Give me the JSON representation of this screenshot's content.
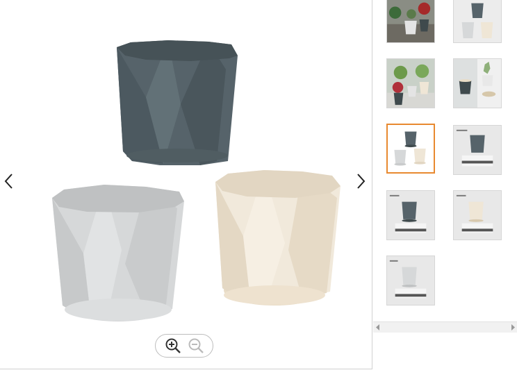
{
  "viewer": {
    "main_image_icon": "geometric-flower-pots-photo",
    "prev_icon": "chevron-left-icon",
    "next_icon": "chevron-right-icon",
    "zoom_in_icon": "zoom-in-icon",
    "zoom_out_icon": "zoom-out-icon"
  },
  "thumbnails": [
    {
      "icon": "pots-with-plants-photo",
      "selected": false
    },
    {
      "icon": "three-pots-photo",
      "selected": false
    },
    {
      "icon": "pots-with-plants-window-photo",
      "selected": false
    },
    {
      "icon": "pot-with-succulent-photo",
      "selected": false
    },
    {
      "icon": "three-pots-photo",
      "selected": true
    },
    {
      "icon": "dark-pot-size-chart",
      "selected": false
    },
    {
      "icon": "dark-pot-size-chart",
      "selected": false
    },
    {
      "icon": "cream-pot-size-chart",
      "selected": false
    },
    {
      "icon": "grey-pot-size-chart",
      "selected": false
    }
  ],
  "colors": {
    "selected_border": "#e8892f",
    "pot_dark": "#4f5c5f",
    "pot_light": "#d9dbdc",
    "pot_cream": "#efe6d6"
  }
}
